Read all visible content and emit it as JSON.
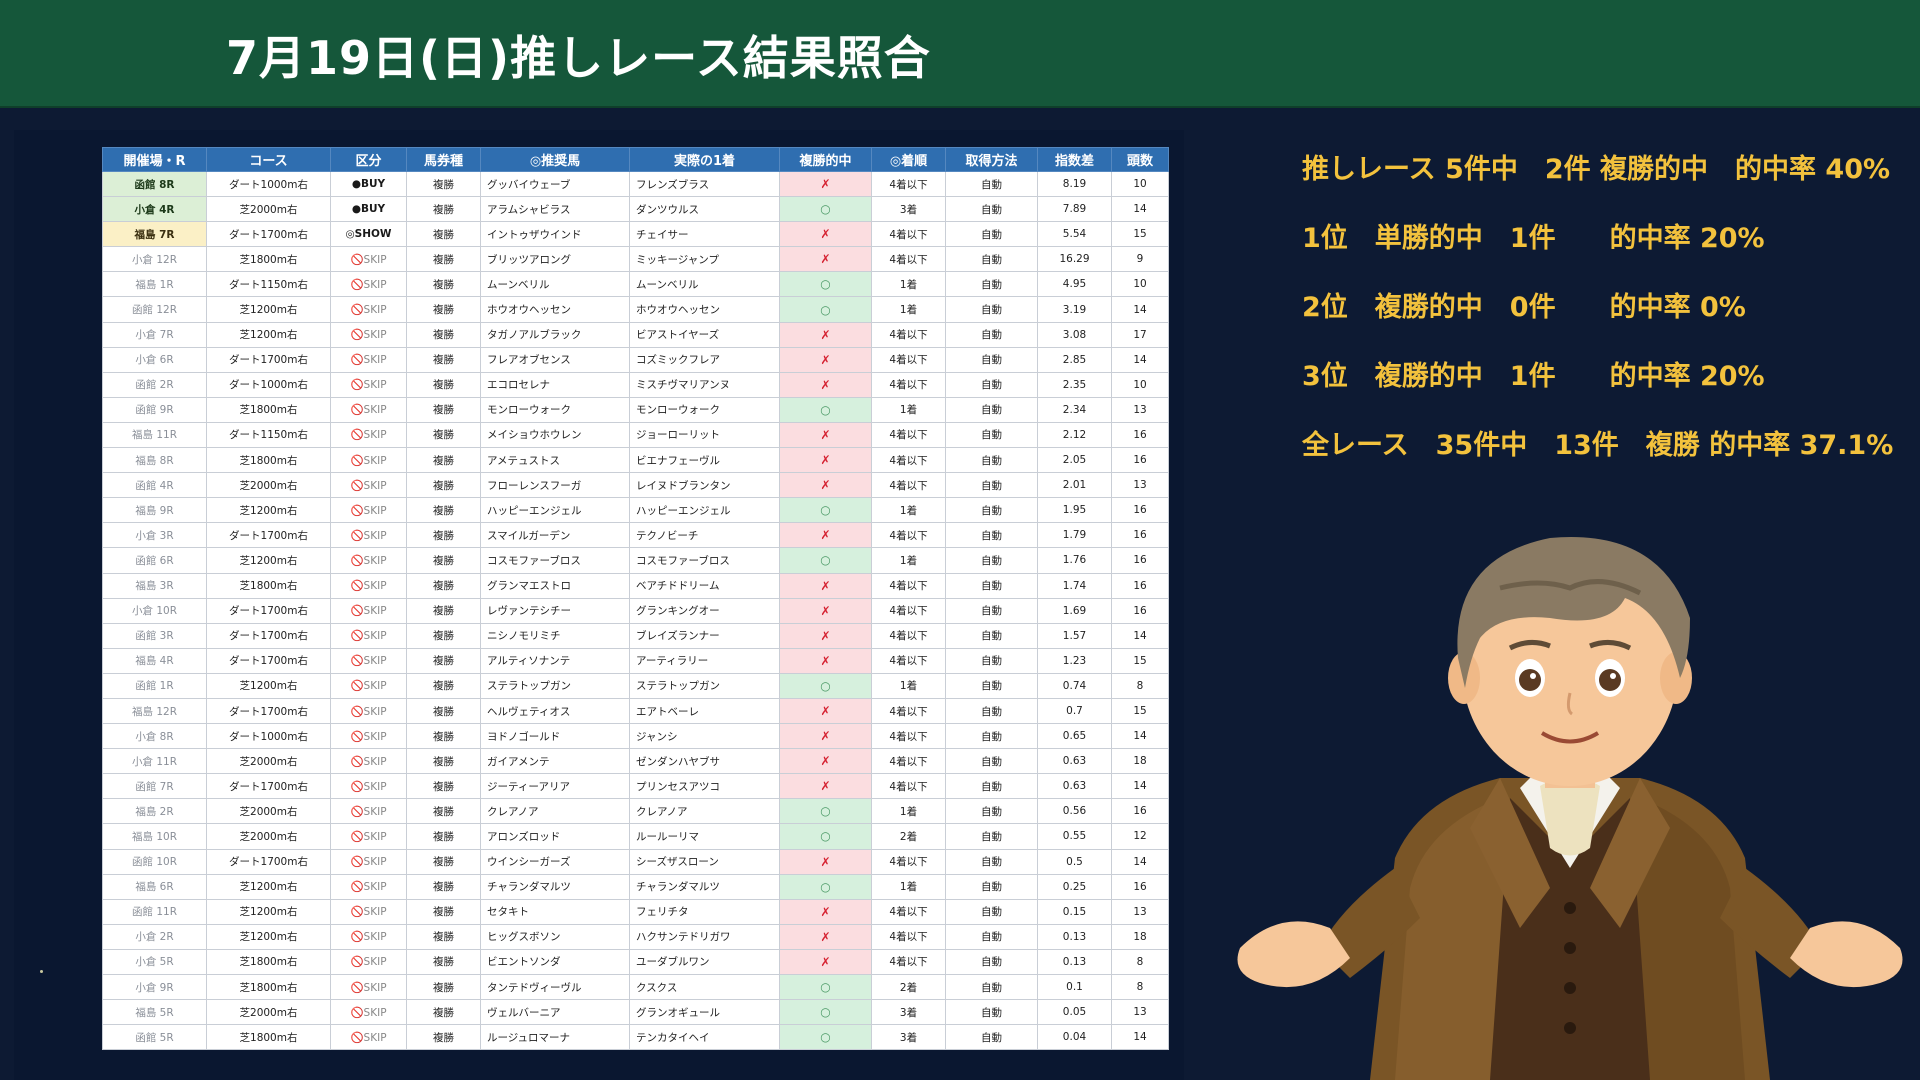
{
  "header": {
    "title": "7月19日(日)推しレース結果照合"
  },
  "table": {
    "columns": [
      "開催場・R",
      "コース",
      "区分",
      "馬券種",
      "◎推奨馬",
      "実際の1着",
      "複勝的中",
      "◎着順",
      "取得方法",
      "指数差",
      "頭数"
    ],
    "rows": [
      {
        "venue": "函館 8R",
        "course": "ダート1000m右",
        "category": "●BUY",
        "bet": "複勝",
        "pick": "グッバイウェーブ",
        "winner": "フレンズブラス",
        "hit": "✗",
        "rank": "4着以下",
        "method": "自動",
        "diff": "8.19",
        "count": "10"
      },
      {
        "venue": "小倉 4R",
        "course": "芝2000m右",
        "category": "●BUY",
        "bet": "複勝",
        "pick": "アラムシャビラス",
        "winner": "ダンツウルス",
        "hit": "○",
        "rank": "3着",
        "method": "自動",
        "diff": "7.89",
        "count": "14"
      },
      {
        "venue": "福島 7R",
        "course": "ダート1700m右",
        "category": "◎SHOW",
        "bet": "複勝",
        "pick": "イントゥザウインド",
        "winner": "チェイサー",
        "hit": "✗",
        "rank": "4着以下",
        "method": "自動",
        "diff": "5.54",
        "count": "15"
      },
      {
        "venue": "小倉 12R",
        "course": "芝1800m右",
        "category": "🚫SKIP",
        "bet": "複勝",
        "pick": "ブリッツアロング",
        "winner": "ミッキージャンプ",
        "hit": "✗",
        "rank": "4着以下",
        "method": "自動",
        "diff": "16.29",
        "count": "9"
      },
      {
        "venue": "福島 1R",
        "course": "ダート1150m右",
        "category": "🚫SKIP",
        "bet": "複勝",
        "pick": "ムーンベリル",
        "winner": "ムーンベリル",
        "hit": "○",
        "rank": "1着",
        "method": "自動",
        "diff": "4.95",
        "count": "10"
      },
      {
        "venue": "函館 12R",
        "course": "芝1200m右",
        "category": "🚫SKIP",
        "bet": "複勝",
        "pick": "ホウオウヘッセン",
        "winner": "ホウオウヘッセン",
        "hit": "○",
        "rank": "1着",
        "method": "自動",
        "diff": "3.19",
        "count": "14"
      },
      {
        "venue": "小倉 7R",
        "course": "芝1200m右",
        "category": "🚫SKIP",
        "bet": "複勝",
        "pick": "タガノアルブラック",
        "winner": "ビアストイヤーズ",
        "hit": "✗",
        "rank": "4着以下",
        "method": "自動",
        "diff": "3.08",
        "count": "17"
      },
      {
        "venue": "小倉 6R",
        "course": "ダート1700m右",
        "category": "🚫SKIP",
        "bet": "複勝",
        "pick": "フレアオブセンス",
        "winner": "コズミックフレア",
        "hit": "✗",
        "rank": "4着以下",
        "method": "自動",
        "diff": "2.85",
        "count": "14"
      },
      {
        "venue": "函館 2R",
        "course": "ダート1000m右",
        "category": "🚫SKIP",
        "bet": "複勝",
        "pick": "エコロセレナ",
        "winner": "ミスチヴマリアンヌ",
        "hit": "✗",
        "rank": "4着以下",
        "method": "自動",
        "diff": "2.35",
        "count": "10"
      },
      {
        "venue": "函館 9R",
        "course": "芝1800m右",
        "category": "🚫SKIP",
        "bet": "複勝",
        "pick": "モンローウォーク",
        "winner": "モンローウォーク",
        "hit": "○",
        "rank": "1着",
        "method": "自動",
        "diff": "2.34",
        "count": "13"
      },
      {
        "venue": "福島 11R",
        "course": "ダート1150m右",
        "category": "🚫SKIP",
        "bet": "複勝",
        "pick": "メイショウホウレン",
        "winner": "ジョーローリット",
        "hit": "✗",
        "rank": "4着以下",
        "method": "自動",
        "diff": "2.12",
        "count": "16"
      },
      {
        "venue": "福島 8R",
        "course": "芝1800m右",
        "category": "🚫SKIP",
        "bet": "複勝",
        "pick": "アメテュストス",
        "winner": "ビエナフェーヴル",
        "hit": "✗",
        "rank": "4着以下",
        "method": "自動",
        "diff": "2.05",
        "count": "16"
      },
      {
        "venue": "函館 4R",
        "course": "芝2000m右",
        "category": "🚫SKIP",
        "bet": "複勝",
        "pick": "フローレンスフーガ",
        "winner": "レイヌドブランタン",
        "hit": "✗",
        "rank": "4着以下",
        "method": "自動",
        "diff": "2.01",
        "count": "13"
      },
      {
        "venue": "福島 9R",
        "course": "芝1200m右",
        "category": "🚫SKIP",
        "bet": "複勝",
        "pick": "ハッピーエンジェル",
        "winner": "ハッピーエンジェル",
        "hit": "○",
        "rank": "1着",
        "method": "自動",
        "diff": "1.95",
        "count": "16"
      },
      {
        "venue": "小倉 3R",
        "course": "ダート1700m右",
        "category": "🚫SKIP",
        "bet": "複勝",
        "pick": "スマイルガーデン",
        "winner": "テクノビーチ",
        "hit": "✗",
        "rank": "4着以下",
        "method": "自動",
        "diff": "1.79",
        "count": "16"
      },
      {
        "venue": "函館 6R",
        "course": "芝1200m右",
        "category": "🚫SKIP",
        "bet": "複勝",
        "pick": "コスモファーブロス",
        "winner": "コスモファーブロス",
        "hit": "○",
        "rank": "1着",
        "method": "自動",
        "diff": "1.76",
        "count": "16"
      },
      {
        "venue": "福島 3R",
        "course": "芝1800m右",
        "category": "🚫SKIP",
        "bet": "複勝",
        "pick": "グランマエストロ",
        "winner": "ベアチドドリーム",
        "hit": "✗",
        "rank": "4着以下",
        "method": "自動",
        "diff": "1.74",
        "count": "16"
      },
      {
        "venue": "小倉 10R",
        "course": "ダート1700m右",
        "category": "🚫SKIP",
        "bet": "複勝",
        "pick": "レヴァンテシチー",
        "winner": "グランキングオー",
        "hit": "✗",
        "rank": "4着以下",
        "method": "自動",
        "diff": "1.69",
        "count": "16"
      },
      {
        "venue": "函館 3R",
        "course": "ダート1700m右",
        "category": "🚫SKIP",
        "bet": "複勝",
        "pick": "ニシノモリミチ",
        "winner": "ブレイズランナー",
        "hit": "✗",
        "rank": "4着以下",
        "method": "自動",
        "diff": "1.57",
        "count": "14"
      },
      {
        "venue": "福島 4R",
        "course": "ダート1700m右",
        "category": "🚫SKIP",
        "bet": "複勝",
        "pick": "アルティソナンテ",
        "winner": "アーティラリー",
        "hit": "✗",
        "rank": "4着以下",
        "method": "自動",
        "diff": "1.23",
        "count": "15"
      },
      {
        "venue": "函館 1R",
        "course": "芝1200m右",
        "category": "🚫SKIP",
        "bet": "複勝",
        "pick": "ステラトップガン",
        "winner": "ステラトップガン",
        "hit": "○",
        "rank": "1着",
        "method": "自動",
        "diff": "0.74",
        "count": "8"
      },
      {
        "venue": "福島 12R",
        "course": "ダート1700m右",
        "category": "🚫SKIP",
        "bet": "複勝",
        "pick": "ヘルヴェティオス",
        "winner": "エアトベーレ",
        "hit": "✗",
        "rank": "4着以下",
        "method": "自動",
        "diff": "0.7",
        "count": "15"
      },
      {
        "venue": "小倉 8R",
        "course": "ダート1000m右",
        "category": "🚫SKIP",
        "bet": "複勝",
        "pick": "ヨドノゴールド",
        "winner": "ジャンシ",
        "hit": "✗",
        "rank": "4着以下",
        "method": "自動",
        "diff": "0.65",
        "count": "14"
      },
      {
        "venue": "小倉 11R",
        "course": "芝2000m右",
        "category": "🚫SKIP",
        "bet": "複勝",
        "pick": "ガイアメンテ",
        "winner": "ゼンダンハヤブサ",
        "hit": "✗",
        "rank": "4着以下",
        "method": "自動",
        "diff": "0.63",
        "count": "18"
      },
      {
        "venue": "函館 7R",
        "course": "ダート1700m右",
        "category": "🚫SKIP",
        "bet": "複勝",
        "pick": "ジーティーアリア",
        "winner": "プリンセスアツコ",
        "hit": "✗",
        "rank": "4着以下",
        "method": "自動",
        "diff": "0.63",
        "count": "14"
      },
      {
        "venue": "福島 2R",
        "course": "芝2000m右",
        "category": "🚫SKIP",
        "bet": "複勝",
        "pick": "クレアノア",
        "winner": "クレアノア",
        "hit": "○",
        "rank": "1着",
        "method": "自動",
        "diff": "0.56",
        "count": "16"
      },
      {
        "venue": "福島 10R",
        "course": "芝2000m右",
        "category": "🚫SKIP",
        "bet": "複勝",
        "pick": "アロンズロッド",
        "winner": "ルールーリマ",
        "hit": "○",
        "rank": "2着",
        "method": "自動",
        "diff": "0.55",
        "count": "12"
      },
      {
        "venue": "函館 10R",
        "course": "ダート1700m右",
        "category": "🚫SKIP",
        "bet": "複勝",
        "pick": "ウインシーガーズ",
        "winner": "シーズザスローン",
        "hit": "✗",
        "rank": "4着以下",
        "method": "自動",
        "diff": "0.5",
        "count": "14"
      },
      {
        "venue": "福島 6R",
        "course": "芝1200m右",
        "category": "🚫SKIP",
        "bet": "複勝",
        "pick": "チャランダマルツ",
        "winner": "チャランダマルツ",
        "hit": "○",
        "rank": "1着",
        "method": "自動",
        "diff": "0.25",
        "count": "16"
      },
      {
        "venue": "函館 11R",
        "course": "芝1200m右",
        "category": "🚫SKIP",
        "bet": "複勝",
        "pick": "セタキト",
        "winner": "フェリチタ",
        "hit": "✗",
        "rank": "4着以下",
        "method": "自動",
        "diff": "0.15",
        "count": "13"
      },
      {
        "venue": "小倉 2R",
        "course": "芝1200m右",
        "category": "🚫SKIP",
        "bet": "複勝",
        "pick": "ヒッグスボソン",
        "winner": "ハクサンテドリガワ",
        "hit": "✗",
        "rank": "4着以下",
        "method": "自動",
        "diff": "0.13",
        "count": "18"
      },
      {
        "venue": "小倉 5R",
        "course": "芝1800m右",
        "category": "🚫SKIP",
        "bet": "複勝",
        "pick": "ビエントソンダ",
        "winner": "ユーダブルワン",
        "hit": "✗",
        "rank": "4着以下",
        "method": "自動",
        "diff": "0.13",
        "count": "8"
      },
      {
        "venue": "小倉 9R",
        "course": "芝1800m右",
        "category": "🚫SKIP",
        "bet": "複勝",
        "pick": "タンテドヴィーヴル",
        "winner": "クスクス",
        "hit": "○",
        "rank": "2着",
        "method": "自動",
        "diff": "0.1",
        "count": "8"
      },
      {
        "venue": "福島 5R",
        "course": "芝2000m右",
        "category": "🚫SKIP",
        "bet": "複勝",
        "pick": "ヴェルバーニア",
        "winner": "グランオギュール",
        "hit": "○",
        "rank": "3着",
        "method": "自動",
        "diff": "0.05",
        "count": "13"
      },
      {
        "venue": "函館 5R",
        "course": "芝1800m右",
        "category": "🚫SKIP",
        "bet": "複勝",
        "pick": "ルージュロマーナ",
        "winner": "テンカタイヘイ",
        "hit": "○",
        "rank": "3着",
        "method": "自動",
        "diff": "0.04",
        "count": "14"
      }
    ]
  },
  "summary": [
    "推しレース 5件中　2件 複勝的中　的中率 40%",
    "1位　単勝的中　1件　　的中率 20%",
    "2位　複勝的中　0件　　的中率 0%",
    "3位　複勝的中　1件　　的中率 20%",
    "全レース　35件中　13件　複勝 的中率 37.1%"
  ],
  "colors": {
    "header_bg": "#15573a",
    "page_bg": "#0d1a33",
    "table_header_bg": "#2f6eb0",
    "accent_text": "#f3c23d",
    "hit_bg": "#d6f0dd",
    "miss_bg": "#fbdde0",
    "miss_mark": "#d52030"
  },
  "icons": {
    "mascot": "mascot-illustration",
    "skip": "no-entry-icon"
  }
}
